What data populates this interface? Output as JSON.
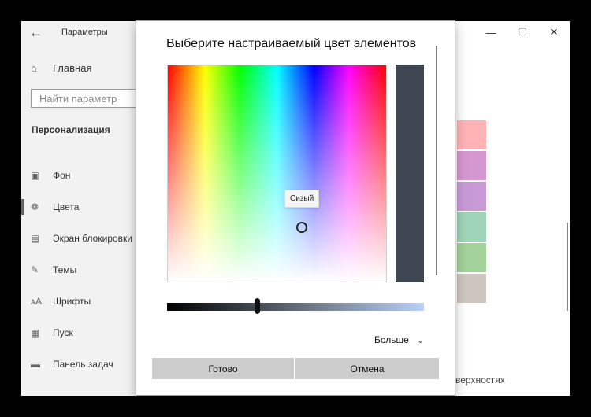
{
  "settings": {
    "app_title": "Параметры",
    "home_label": "Главная",
    "search_placeholder": "Найти параметр",
    "section_title": "Персонализация",
    "nav_items": [
      {
        "label": "Фон",
        "icon": "image-icon"
      },
      {
        "label": "Цвета",
        "icon": "palette-icon"
      },
      {
        "label": "Экран блокировки",
        "icon": "lock-screen-icon"
      },
      {
        "label": "Темы",
        "icon": "themes-icon"
      },
      {
        "label": "Шрифты",
        "icon": "fonts-icon"
      },
      {
        "label": "Пуск",
        "icon": "start-icon"
      },
      {
        "label": "Панель задач",
        "icon": "taskbar-icon"
      }
    ],
    "active_item": "Цвета",
    "swatch_colors": [
      "#ffb3b5",
      "#d597d0",
      "#c79ad6",
      "#a0d4b8",
      "#a3d29b",
      "#ccc6be"
    ],
    "bottom_text": "верхностях"
  },
  "dialog": {
    "title": "Выберите настраиваемый цвет элементов",
    "tooltip": "Сизый",
    "preview_color": "#3f4753",
    "brightness_level": 0.35,
    "more_label": "Больше",
    "ok_label": "Готово",
    "cancel_label": "Отмена"
  }
}
